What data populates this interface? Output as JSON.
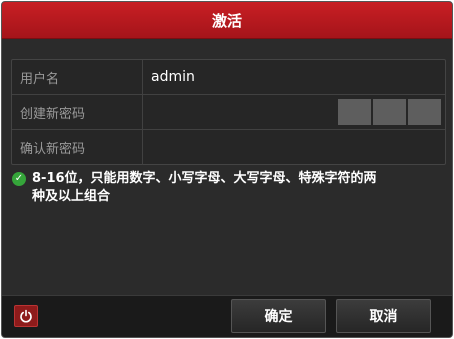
{
  "dialog": {
    "title": "激活"
  },
  "form": {
    "rows": [
      {
        "label": "用户名",
        "value": "admin"
      },
      {
        "label": "创建新密码",
        "value": ""
      },
      {
        "label": "确认新密码",
        "value": ""
      }
    ],
    "password_strength": {
      "filled_segments": 0,
      "total_segments": 3
    }
  },
  "hint": {
    "icon": "check-circle-icon",
    "line1": "8-16位，只能用数字、小写字母、大写字母、特殊字符的两",
    "line2": "种及以上组合"
  },
  "footer": {
    "power_icon": "power-icon",
    "ok_label": "确定",
    "cancel_label": "取消"
  },
  "colors": {
    "title_bar": "#c81f24",
    "panel": "#2b2b2b",
    "strength_empty": "#5e5e5e",
    "check": "#35a53a"
  }
}
